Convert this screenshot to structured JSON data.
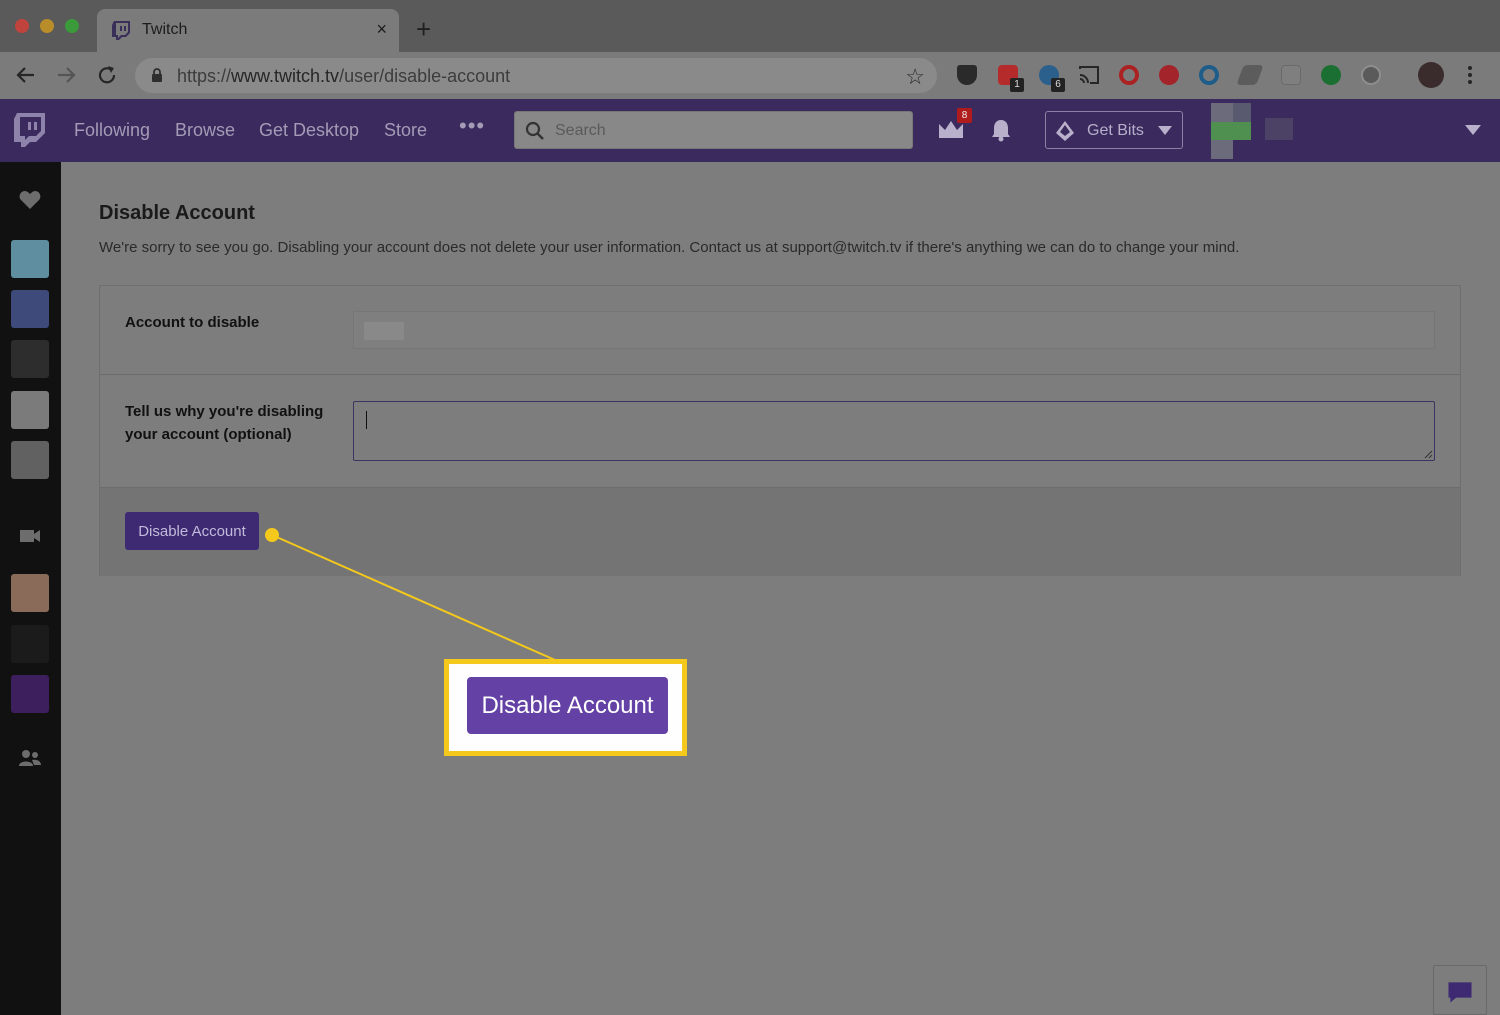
{
  "browser": {
    "tab_title": "Twitch",
    "tab_close": "×",
    "new_tab": "+",
    "url_prefix": "https://",
    "url_host": "www.twitch.tv",
    "url_path": "/user/disable-account",
    "star": "☆",
    "extension_badges": [
      "1",
      "6"
    ]
  },
  "topnav": {
    "links": [
      "Following",
      "Browse",
      "Get Desktop",
      "Store"
    ],
    "more": "•••",
    "search_placeholder": "Search",
    "crown_badge": "8",
    "get_bits_label": "Get Bits"
  },
  "page": {
    "title": "Disable Account",
    "description": "We're sorry to see you go. Disabling your account does not delete your user information. Contact us at support@twitch.tv if there's anything we can do to change your mind.",
    "account_label": "Account to disable",
    "reason_label_line1": "Tell us why you're disabling",
    "reason_label_line2": "your account (optional)",
    "reason_value": "",
    "submit_label": "Disable Account"
  },
  "callout": {
    "button_label": "Disable Account",
    "color": "#f4c91b"
  },
  "colors": {
    "twitch_purple": "#6441a4",
    "nav_bg": "#3a2a5e",
    "sidebar_bg": "#111111"
  }
}
